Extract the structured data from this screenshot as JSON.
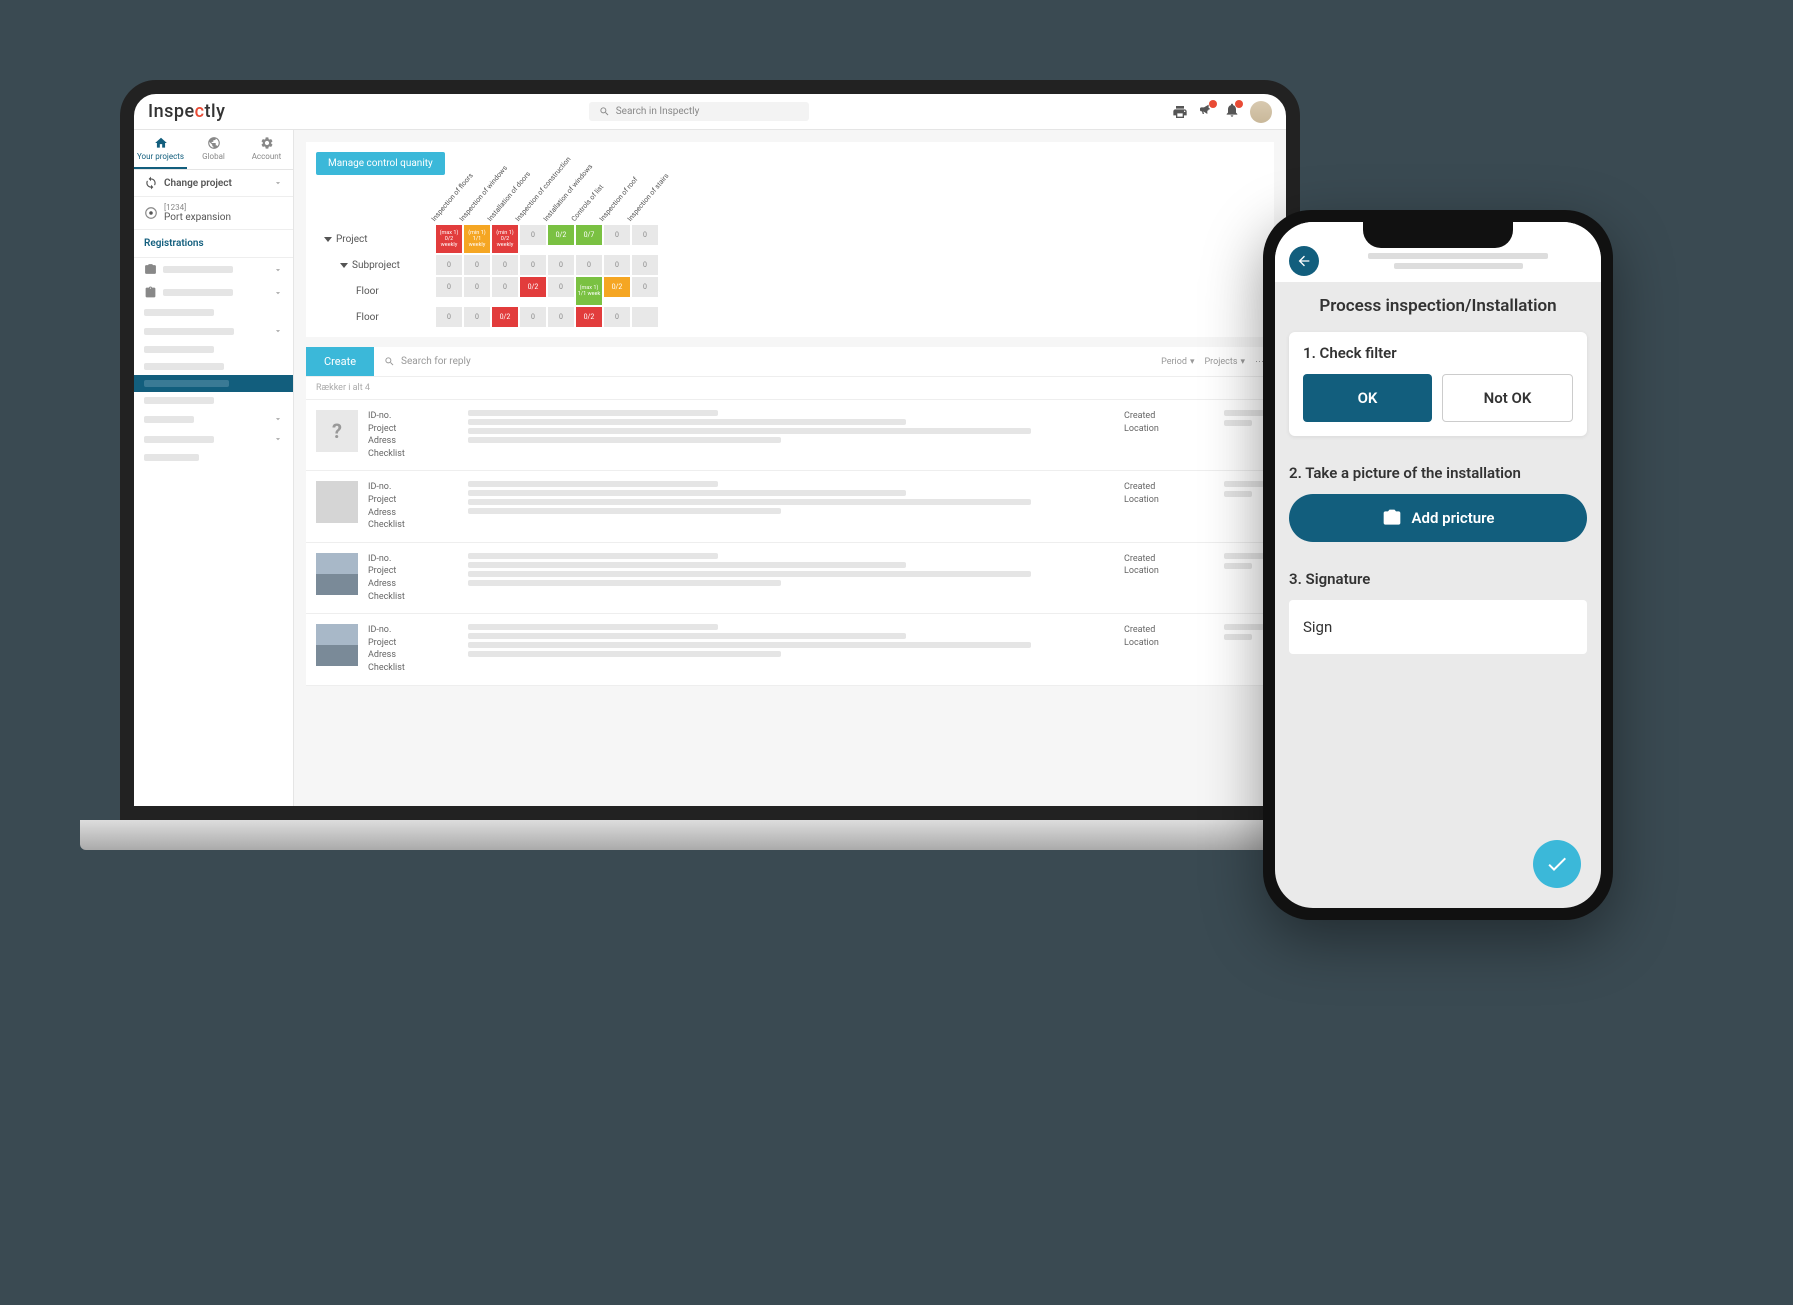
{
  "desktop": {
    "logo_pre": "Inspe",
    "logo_c": "c",
    "logo_post": "tly",
    "search_placeholder": "Search in Inspectly",
    "nav": {
      "projects": "Your projects",
      "global": "Global",
      "account": "Account"
    },
    "change_project": "Change project",
    "project_code": "[1234]",
    "project_name": "Port expansion",
    "registrations": "Registrations",
    "manage_btn": "Manage control quanity",
    "matrix_headers": [
      "Inspection of floors",
      "Inspection of windows",
      "Installation of doors",
      "Inspection of construction",
      "Installation of windows",
      "Controls of list",
      "Inspection of roof",
      "Inspection of stairs"
    ],
    "matrix_rows": [
      {
        "label": "Project",
        "indent": 0,
        "cells": [
          {
            "t": "(max 1)\n0/2\nweekly",
            "c": "red"
          },
          {
            "t": "(min 1)\n1/1\nweekly",
            "c": "orange"
          },
          {
            "t": "(min 1)\n0/2\nweekly",
            "c": "red"
          },
          {
            "t": "0"
          },
          {
            "t": "0/2",
            "c": "green"
          },
          {
            "t": "0/7",
            "c": "green"
          },
          {
            "t": "0"
          },
          {
            "t": "0"
          }
        ]
      },
      {
        "label": "Subproject",
        "indent": 1,
        "cells": [
          {
            "t": "0"
          },
          {
            "t": "0"
          },
          {
            "t": "0"
          },
          {
            "t": "0"
          },
          {
            "t": "0"
          },
          {
            "t": "0"
          },
          {
            "t": "0"
          },
          {
            "t": "0"
          }
        ]
      },
      {
        "label": "Floor",
        "indent": 2,
        "cells": [
          {
            "t": "0"
          },
          {
            "t": "0"
          },
          {
            "t": "0"
          },
          {
            "t": "0/2",
            "c": "red"
          },
          {
            "t": "0"
          },
          {
            "t": "(max 1)\n1/1\nweek",
            "c": "green"
          },
          {
            "t": "0/2",
            "c": "orange"
          },
          {
            "t": "0"
          }
        ]
      },
      {
        "label": "Floor",
        "indent": 2,
        "cells": [
          {
            "t": "0"
          },
          {
            "t": "0"
          },
          {
            "t": "0/2",
            "c": "red"
          },
          {
            "t": "0"
          },
          {
            "t": "0"
          },
          {
            "t": "0/2",
            "c": "red"
          },
          {
            "t": "0"
          },
          {
            "t": ""
          }
        ]
      }
    ],
    "create_btn": "Create",
    "search_reply": "Search for reply",
    "filter_period": "Period",
    "filter_projects": "Projects",
    "results": "Rækker i alt 4",
    "reply_labels": [
      "ID-no.",
      "Project",
      "Adress",
      "Checklist"
    ],
    "reply_right": [
      "Created",
      "Location"
    ]
  },
  "phone": {
    "title": "Process inspection/Installation",
    "step1": "1. Check filter",
    "ok": "OK",
    "notok": "Not OK",
    "step2": "2. Take a picture of the installation",
    "add_picture": "Add pricture",
    "step3": "3. Signature",
    "sign": "Sign"
  }
}
